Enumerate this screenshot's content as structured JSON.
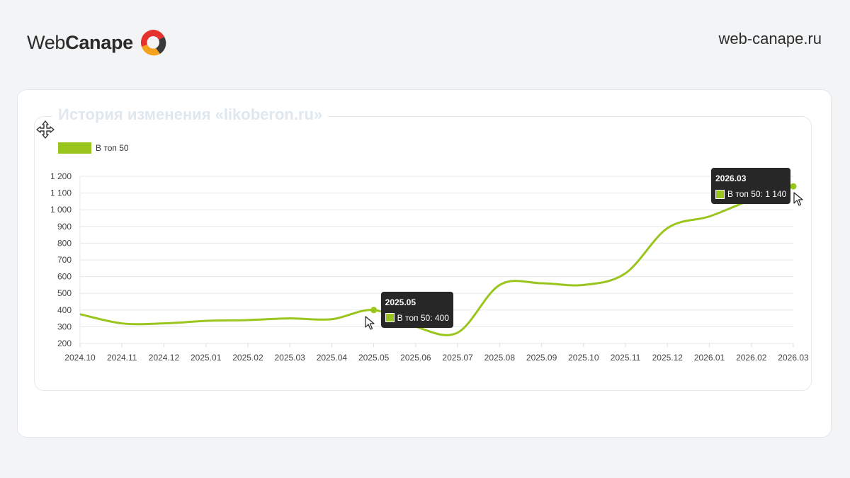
{
  "header": {
    "logo_text_light": "Web",
    "logo_text_bold": "Canape",
    "site_url": "web-canape.ru"
  },
  "panel": {
    "title": "История изменения «likoberon.ru»"
  },
  "colors": {
    "series": "#9ac51d",
    "tooltip_bg": "#272727"
  },
  "icons": {
    "move": "move-arrows-icon",
    "cursor": "mouse-pointer-icon",
    "logo": "webcanape-logo-icon"
  },
  "tooltips": [
    {
      "title": "2025.05",
      "label": "В топ 50: 400",
      "x_index": 7
    },
    {
      "title": "2026.03",
      "label": "В топ 50: 1 140",
      "x_index": 17
    }
  ],
  "chart_data": {
    "type": "line",
    "title": "",
    "xlabel": "",
    "ylabel": "",
    "categories": [
      "2024.10",
      "2024.11",
      "2024.12",
      "2025.01",
      "2025.02",
      "2025.03",
      "2025.04",
      "2025.05",
      "2025.06",
      "2025.07",
      "2025.08",
      "2025.09",
      "2025.10",
      "2025.11",
      "2025.12",
      "2026.01",
      "2026.02",
      "2026.03"
    ],
    "series": [
      {
        "name": "В топ 50",
        "values": [
          375,
          320,
          320,
          335,
          340,
          350,
          345,
          400,
          300,
          265,
          550,
          560,
          550,
          620,
          890,
          960,
          1060,
          1140
        ]
      }
    ],
    "ylim": [
      200,
      1200
    ],
    "yticks": [
      200,
      300,
      400,
      500,
      600,
      700,
      800,
      900,
      1000,
      1100,
      1200
    ],
    "ytick_labels": [
      "200",
      "300",
      "400",
      "500",
      "600",
      "700",
      "800",
      "900",
      "1 000",
      "1 100",
      "1 200"
    ],
    "grid": true,
    "legend": "top-left"
  }
}
